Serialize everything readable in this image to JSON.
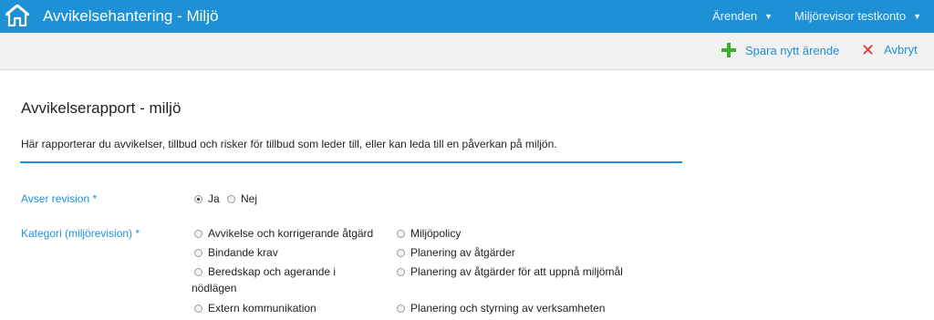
{
  "header": {
    "title": "Avvikelsehantering - Miljö",
    "home_icon": "home-icon",
    "menu_arenden": "Ärenden",
    "menu_account": "Miljörevisor testkonto"
  },
  "toolbar": {
    "save_label": "Spara nytt ärende",
    "cancel_label": "Avbryt",
    "save_icon": "plus-icon",
    "cancel_icon": "close-icon"
  },
  "form": {
    "title": "Avvikelserapport - miljö",
    "intro": "Här rapporterar du avvikelser, tillbud och risker för tillbud som leder till, eller kan leda till en påverkan på miljön.",
    "revision": {
      "label": "Avser revision *",
      "options": [
        "Ja",
        "Nej"
      ],
      "selected": "Ja"
    },
    "kategori": {
      "label": "Kategori (miljörevision) *",
      "options": [
        "Avvikelse och korrigerande åtgärd",
        "Miljöpolicy",
        "Bindande krav",
        "Planering av åtgärder",
        "Beredskap och agerande i nödlägen",
        "Planering av åtgärder för att uppnå miljömål",
        "Extern kommunikation",
        "Planering och styrning av verksamheten"
      ]
    }
  },
  "colors": {
    "brand_blue": "#1e90d6",
    "add_green": "#3fae2a",
    "cancel_red": "#e0302d",
    "toolbar_bg": "#f2f2f2"
  }
}
